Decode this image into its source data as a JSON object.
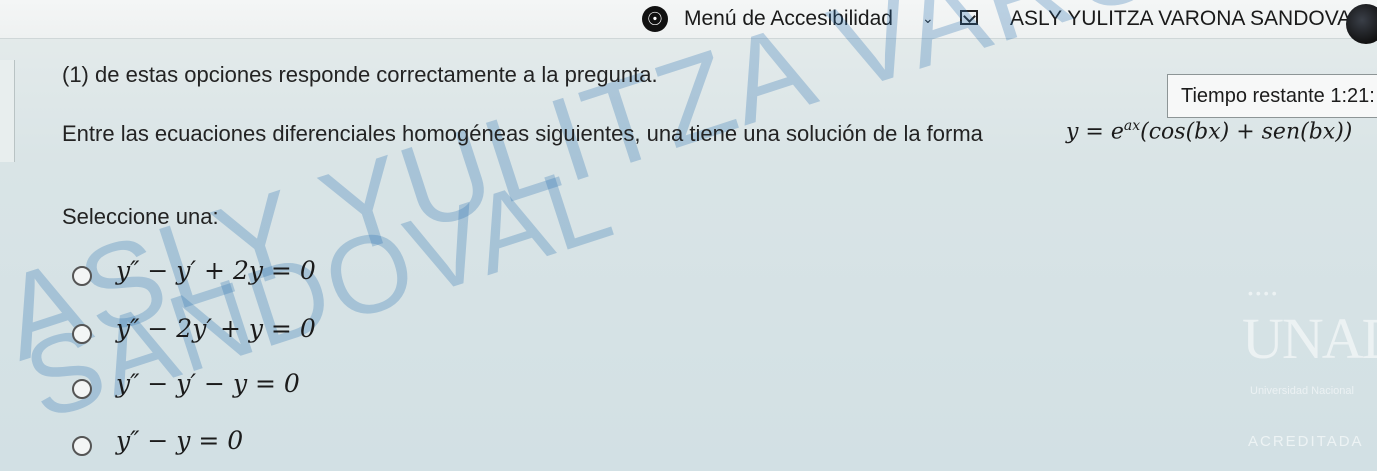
{
  "topbar": {
    "accessibility_menu": "Menú de Accesibilidad",
    "user_name": "ASLY YULITZA VARONA SANDOVAL"
  },
  "quiz": {
    "instruction": "(1) de estas opciones responde correctamente a la pregunta.",
    "timer": "Tiempo restante 1:21:",
    "question": "Entre las ecuaciones diferenciales homogéneas siguientes, una tiene una solución de la forma",
    "formula_lhs": "y = e",
    "formula_exp": "ax",
    "formula_rhs": "(cos(bx) + sen(bx))",
    "select_label": "Seleccione una:",
    "options": [
      "y″ − y′ + 2y = 0",
      "y″ − 2y′ + y = 0",
      "y″ − y′ − y = 0",
      "y″ − y = 0"
    ]
  },
  "watermark": {
    "line1": "ASLY YULITZA VARONA",
    "line2": "SANDOVAL"
  },
  "logo": {
    "letters": "UNAD",
    "subtitle": "Universidad Nacional",
    "accredited": "ACREDITADA"
  },
  "colors": {
    "watermark": "#286eaf",
    "background": "#d9e4e6"
  }
}
